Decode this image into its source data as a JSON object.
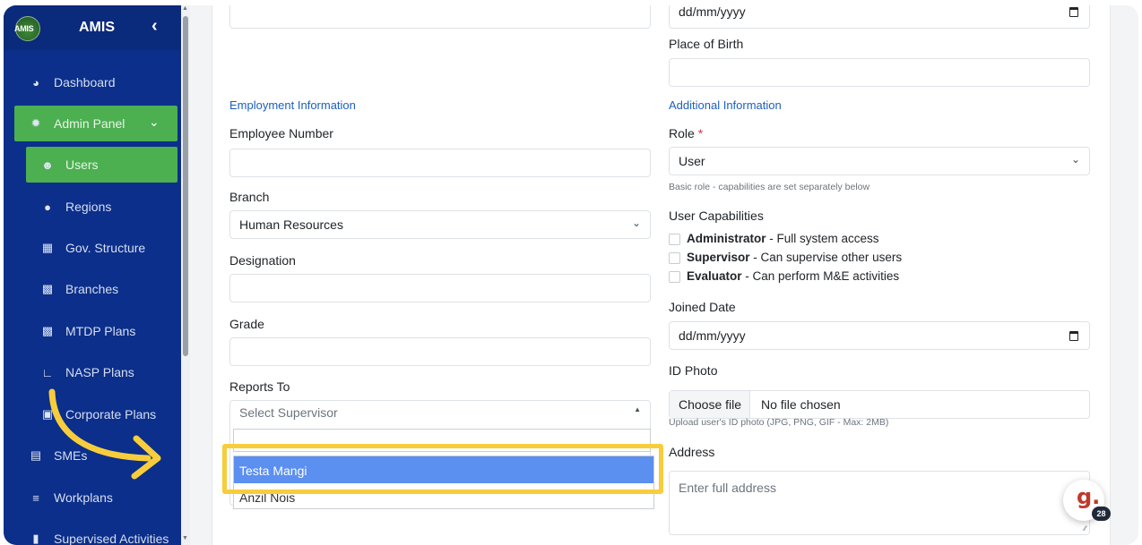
{
  "sidebar": {
    "brand_logo_text": "AMIS",
    "brand_title": "AMIS",
    "collapse_icon": "chevron-left-icon",
    "items": [
      {
        "label": "Dashboard",
        "icon": "dashboard-icon"
      },
      {
        "label": "Admin Panel",
        "icon": "gear-icon"
      },
      {
        "label": "Users",
        "icon": "users-icon"
      },
      {
        "label": "Regions",
        "icon": "map-pin-icon"
      },
      {
        "label": "Gov. Structure",
        "icon": "sitemap-icon"
      },
      {
        "label": "Branches",
        "icon": "building-icon"
      },
      {
        "label": "MTDP Plans",
        "icon": "project-diagram-icon"
      },
      {
        "label": "NASP Plans",
        "icon": "chart-line-icon"
      },
      {
        "label": "Corporate Plans",
        "icon": "briefcase-icon"
      },
      {
        "label": "SMEs",
        "icon": "store-icon"
      },
      {
        "label": "Workplans",
        "icon": "list-icon"
      },
      {
        "label": "Supervised Activities",
        "icon": "clipboard-icon"
      }
    ]
  },
  "form": {
    "top_date_placeholder": "dd/mm/yyyy",
    "place_of_birth_label": "Place of Birth",
    "employment_section": "Employment Information",
    "employee_number_label": "Employee Number",
    "branch_label": "Branch",
    "branch_value": "Human Resources",
    "designation_label": "Designation",
    "grade_label": "Grade",
    "reports_to_label": "Reports To",
    "reports_to_placeholder": "Select Supervisor",
    "additional_section": "Additional Information",
    "role_label": "Role",
    "role_required": "*",
    "role_value": "User",
    "role_help": "Basic role - capabilities are set separately below",
    "capabilities_label": "User Capabilities",
    "capabilities": [
      {
        "name": "Administrator",
        "desc": " - Full system access",
        "checked": false
      },
      {
        "name": "Supervisor",
        "desc": " - Can supervise other users",
        "checked": false
      },
      {
        "name": "Evaluator",
        "desc": " - Can perform M&E activities",
        "checked": false
      }
    ],
    "joined_date_label": "Joined Date",
    "joined_date_placeholder": "dd/mm/yyyy",
    "id_photo_label": "ID Photo",
    "choose_file_label": "Choose file",
    "no_file_label": "No file chosen",
    "id_photo_help": "Upload user's ID photo (JPG, PNG, GIF - Max: 2MB)",
    "address_label": "Address",
    "address_placeholder": "Enter full address"
  },
  "dropdown": {
    "options": [
      "Testa Mangi",
      "Anzil Nois"
    ],
    "highlighted": "Testa Mangi"
  },
  "annotation": {
    "highlight_color": "#f8cd3c",
    "arrow_color": "#f8cd3c"
  },
  "fab": {
    "letter": "g.",
    "count": "28"
  },
  "colors": {
    "sidebar_bg": "#0b2f8a",
    "active_green": "#4caf50",
    "section_blue": "#1d5fbf",
    "option_highlight": "#5b8ff0"
  }
}
